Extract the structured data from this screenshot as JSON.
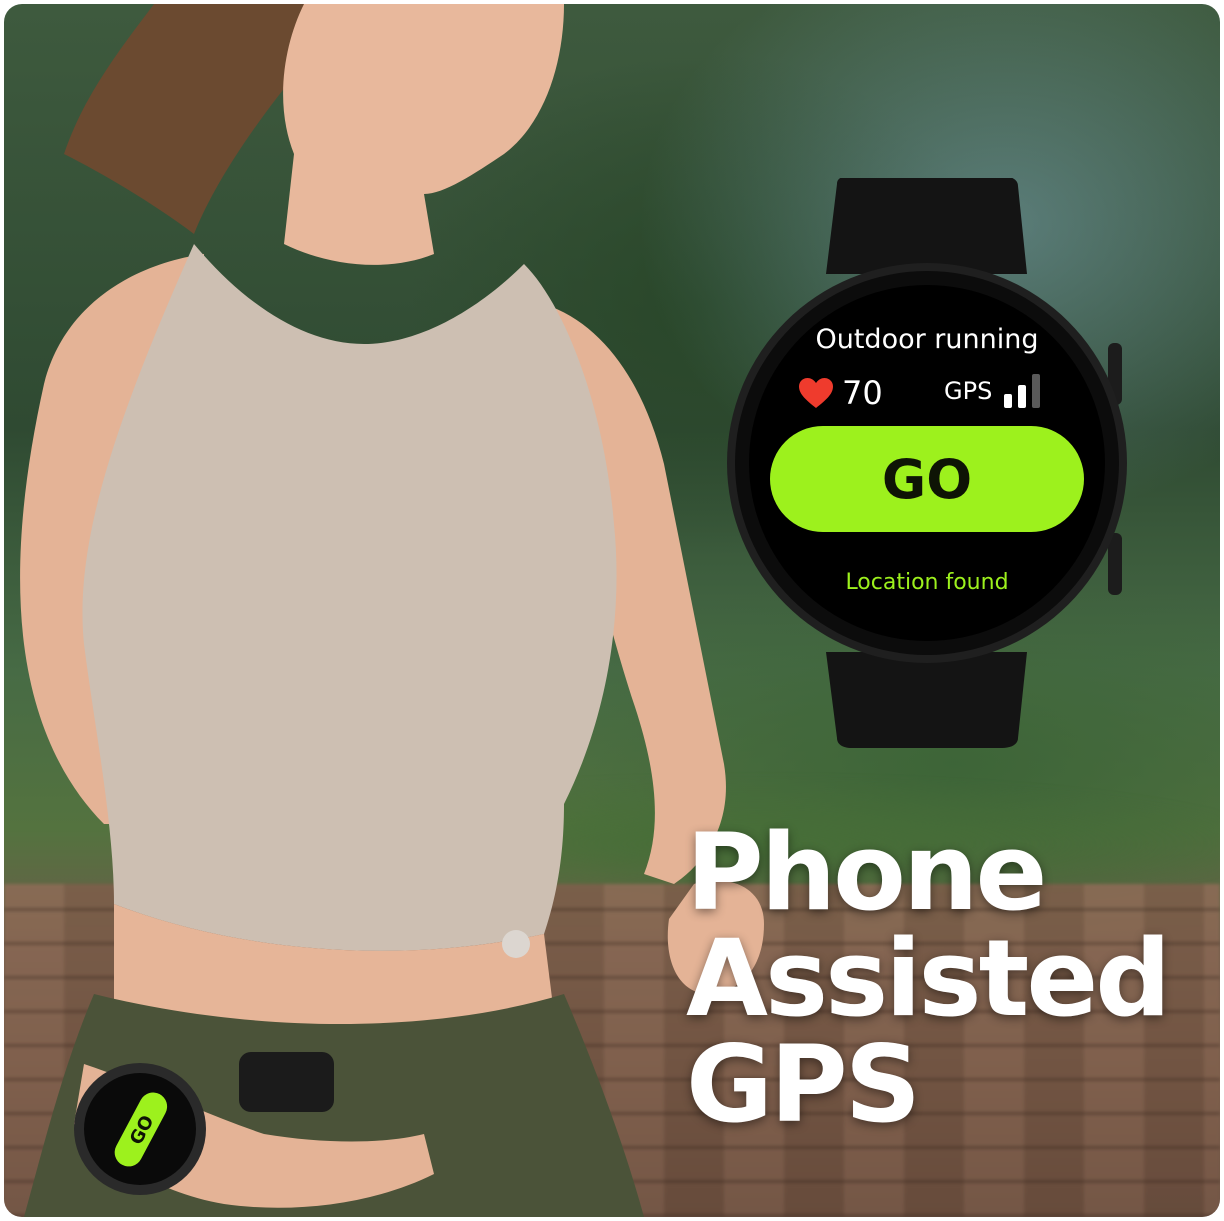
{
  "watch_screen": {
    "title": "Outdoor running",
    "heart_rate": "70",
    "gps_label": "GPS",
    "go_label": "GO",
    "status": "Location found"
  },
  "headline": {
    "line1": "Phone",
    "line2": "Assisted",
    "line3": "GPS"
  },
  "wrist_watch": {
    "go_label": "GO"
  },
  "colors": {
    "accent_green": "#9df11d",
    "heart_red": "#ef3b2d",
    "watch_body": "#151515"
  },
  "icons": [
    "heart-icon",
    "signal-bars-icon"
  ]
}
